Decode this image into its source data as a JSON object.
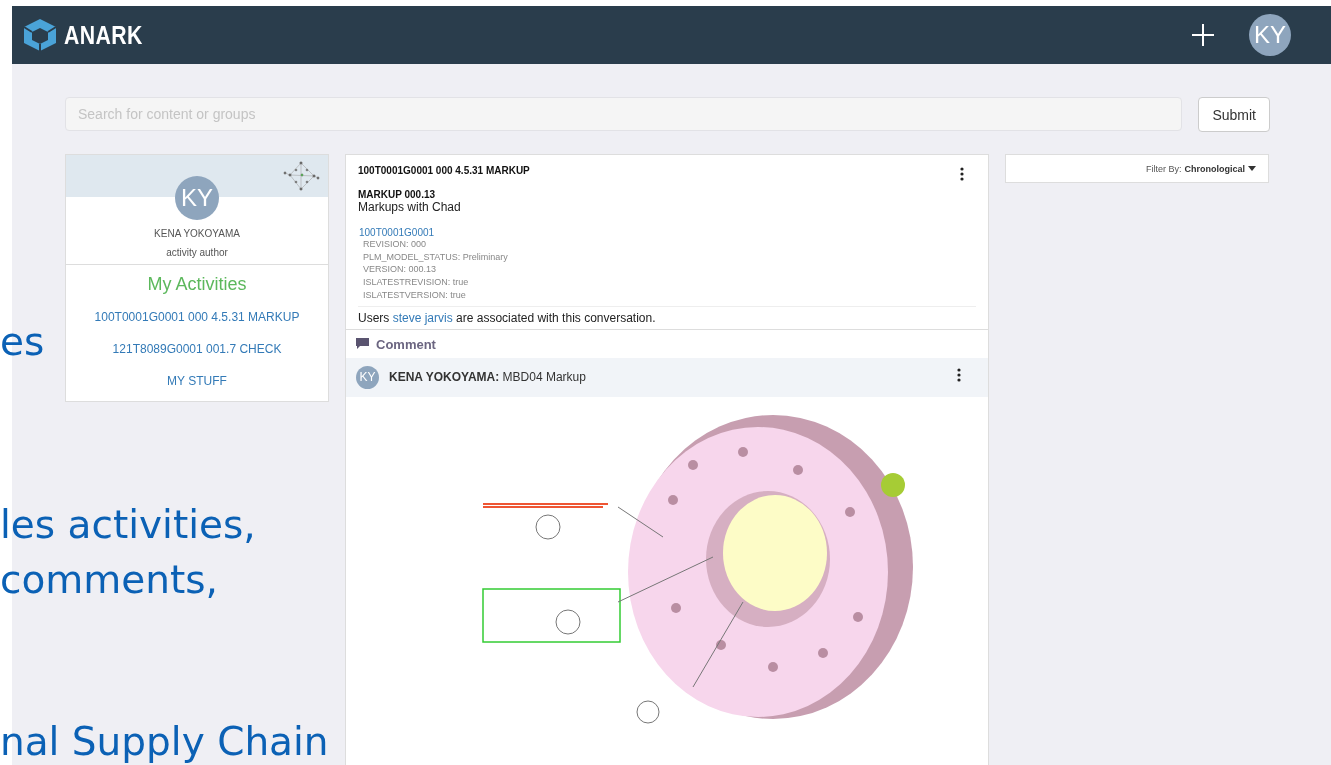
{
  "header": {
    "logo": "ANARK",
    "user_initials": "KY"
  },
  "search": {
    "placeholder": "Search for content or groups",
    "button": "Submit"
  },
  "profile": {
    "initials": "KY",
    "name": "KENA YOKOYAMA",
    "role": "activity author",
    "activities_title": "My Activities",
    "activities": [
      "100T0001G0001 000 4.5.31 MARKUP",
      "121T8089G0001 001.7 CHECK",
      "MY STUFF"
    ]
  },
  "post": {
    "title": "100T0001G0001 000 4.5.31 MARKUP",
    "subtitle": "MARKUP 000.13",
    "description": "Markups with Chad",
    "link": "100T0001G0001",
    "properties": [
      "REVISION: 000",
      "PLM_MODEL_STATUS: Preliminary",
      "VERSION: 000.13",
      "ISLATESTREVISION: true",
      "ISLATESTVERSION: true"
    ],
    "users_prefix": "Users",
    "users_link": "steve jarvis",
    "users_suffix": "are associated with this conversation.",
    "comment_label": "Comment",
    "comment": {
      "initials": "KY",
      "author": "KENA YOKOYAMA:",
      "text": "MBD04 Markup"
    }
  },
  "filter": {
    "label": "Filter By:",
    "value": "Chronological"
  },
  "slide_fragments": [
    "es",
    "les activities,",
    "comments,",
    "nal Supply Chain"
  ]
}
